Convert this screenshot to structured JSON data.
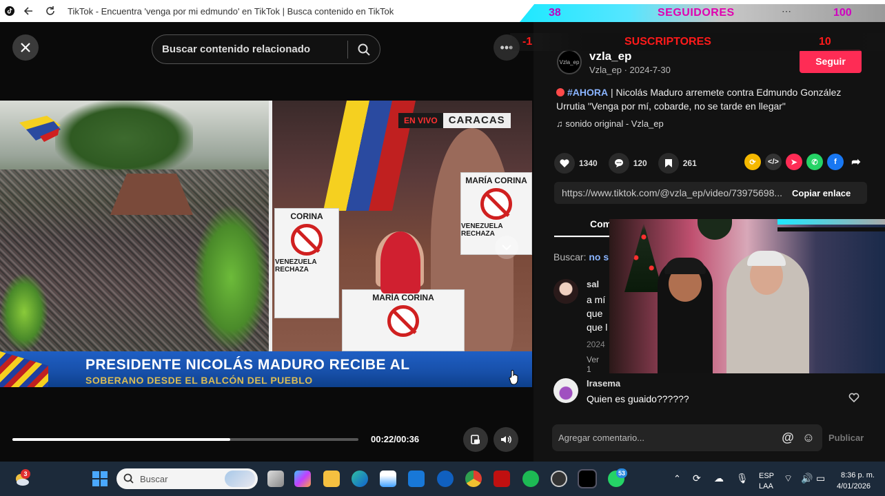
{
  "browser": {
    "title": "TikTok - Encuentra 'venga por mi edmundo' en TikTok | Busca contenido en TikTok"
  },
  "overlay": {
    "followers_count": "38",
    "followers_label": "SEGUIDORES",
    "followers_goal": "100",
    "subscribers_count": "-1",
    "subscribers_label": "SUSCRIPTORES",
    "subscribers_goal": "10"
  },
  "video": {
    "search_placeholder": "Buscar contenido relacionado",
    "live_label": "EN VIVO",
    "city_label": "CARACAS",
    "headline": "PRESIDENTE NICOLÁS MADURO RECIBE AL",
    "subheadline": "SOBERANO DESDE EL BALCÓN DEL PUEBLO",
    "sign_text_1": "MARÍA CORINA",
    "sign_text_2": "MARÍA CORINA",
    "sign_text_3": "CORINA",
    "sign_text_4": "VENEZUELA RECHAZA",
    "sign_text_5": "VENEZUELA RECHAZA",
    "time": "00:22/00:36",
    "progress": 0.63
  },
  "post": {
    "author_name": "vzla_ep",
    "author_handle": "Vzla_ep · 2024-7-30",
    "avatar_text": "Vzla_ep",
    "follow_label": "Seguir",
    "hashtag": "#AHORA",
    "description": " | Nicolás Maduro arremete contra Edmundo González Urrutia \"Venga por mí, cobarde, no se tarde en llegar\"",
    "sound": "sonido original - Vzla_ep",
    "likes": "1340",
    "comments": "120",
    "saves": "261",
    "link": "https://www.tiktok.com/@vzla_ep/video/73975698...",
    "copy_label": "Copiar enlace",
    "tab_label": "Com",
    "search_prefix": "Buscar:",
    "search_query": "no s",
    "comment_placeholder": "Agregar comentario...",
    "publish_label": "Publicar"
  },
  "comments": [
    {
      "name": "sal",
      "lines": [
        "a mí",
        "que",
        "que l"
      ],
      "date": "2024",
      "more": "Ver 1"
    },
    {
      "name": "Irasema",
      "lines": [
        "Quien es guaido??????"
      ]
    }
  ],
  "taskbar": {
    "weather_badge": "3",
    "search_label": "Buscar",
    "whatsapp_badge": "53",
    "lang_1": "ESP",
    "lang_2": "LAA",
    "time": "8:36 p. m.",
    "date": "4/01/2026"
  },
  "colors": {
    "accent": "#fe2c55",
    "link": "#8ab4ff",
    "overlay_pink": "#e000b0",
    "overlay_red": "#ff1a1a"
  }
}
